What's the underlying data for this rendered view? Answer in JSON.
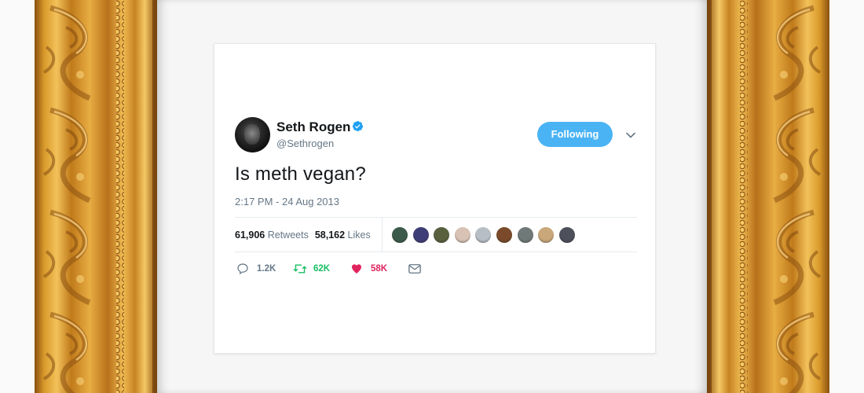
{
  "tweet": {
    "author_name": "Seth Rogen",
    "handle": "@Sethrogen",
    "follow_label": "Following",
    "text": "Is meth vegan?",
    "timestamp": "2:17 PM - 24 Aug 2013",
    "retweets_count": "61,906",
    "retweets_label": "Retweets",
    "likes_count": "58,162",
    "likes_label": "Likes",
    "actions": {
      "replies": "1.2K",
      "retweets": "62K",
      "likes": "58K"
    }
  },
  "colors": {
    "accent": "#4ab3f4",
    "verified": "#1da1f2",
    "retweet": "#17bf63",
    "like": "#e0245e",
    "muted": "#657786",
    "text": "#14171a",
    "frame_gold": "#c9871e"
  },
  "icons": {
    "verified": "verified-badge-icon",
    "chevron": "chevron-down-icon",
    "reply": "reply-icon",
    "retweet": "retweet-icon",
    "like": "heart-icon",
    "message": "envelope-icon"
  },
  "likers": [
    {
      "color": "#3c5a4a"
    },
    {
      "color": "#3f3d77"
    },
    {
      "color": "#58603e"
    },
    {
      "color": "#d8c2b4"
    },
    {
      "color": "#b7bec5"
    },
    {
      "color": "#7a4a2a"
    },
    {
      "color": "#6f7a78"
    },
    {
      "color": "#c9a77a"
    },
    {
      "color": "#4d4f5a"
    }
  ]
}
